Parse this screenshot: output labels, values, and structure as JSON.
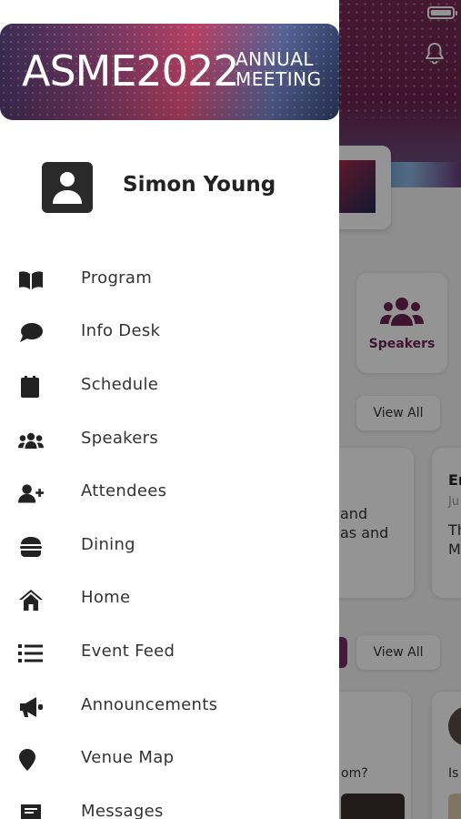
{
  "status_bar": {
    "battery_icon": "battery-full-icon"
  },
  "background": {
    "header_icon": "bell-icon",
    "speakers_tile_label": "Speakers",
    "view_all_1": "View All",
    "view_all_2": "View All",
    "news_card_1_text": "and\nas and",
    "news_card_2_title": "Er",
    "news_card_2_date": "Ju",
    "news_card_2_text": "Th\nM",
    "post_1_text": "om?",
    "post_2_text": "Is"
  },
  "drawer": {
    "banner": {
      "brand": "ASME2022",
      "sub_line_1": "ANNUAL",
      "sub_line_2": "MEETING"
    },
    "user": {
      "name": "Simon Young",
      "avatar_icon": "user-avatar-icon"
    },
    "menu": [
      {
        "label": "Program",
        "icon": "book-open-icon"
      },
      {
        "label": "Info Desk",
        "icon": "chat-bubble-icon"
      },
      {
        "label": "Schedule",
        "icon": "calendar-icon"
      },
      {
        "label": "Speakers",
        "icon": "users-icon"
      },
      {
        "label": "Attendees",
        "icon": "user-plus-icon"
      },
      {
        "label": "Dining",
        "icon": "burger-icon"
      },
      {
        "label": "Home",
        "icon": "home-icon"
      },
      {
        "label": "Event Feed",
        "icon": "list-icon"
      },
      {
        "label": "Announcements",
        "icon": "megaphone-icon"
      },
      {
        "label": "Venue Map",
        "icon": "map-pin-icon"
      },
      {
        "label": "Messages",
        "icon": "message-icon"
      }
    ]
  },
  "colors": {
    "brand_purple": "#6b2450",
    "overlay": "rgba(0,0,0,0.42)"
  }
}
